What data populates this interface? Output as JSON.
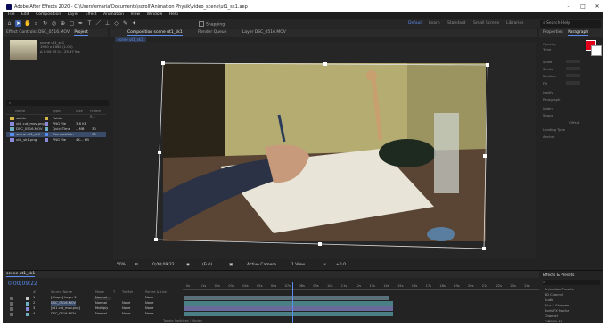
{
  "window": {
    "title": "Adobe After Effects 2020 - C:\\Users\\emaria\\Documents\\scroll\\Animation Physik\\video_scene\\ut1_sk1.aep",
    "controls": [
      "–",
      "□",
      "✕"
    ]
  },
  "menu": [
    "File",
    "Edit",
    "Composition",
    "Layer",
    "Effect",
    "Animation",
    "View",
    "Window",
    "Help"
  ],
  "toolbar": {
    "snapping_label": "Snapping",
    "workspaces": [
      "Default",
      "Learn",
      "Standard",
      "Small Screen",
      "Libraries"
    ],
    "active_workspace": "Default",
    "search_placeholder": "Search Help"
  },
  "project_panel": {
    "tabs": [
      "Effect Controls: DSC_0516.MOV",
      "Project"
    ],
    "active_tab": "Project",
    "thumb_info": [
      "scene ut1_sk1",
      "1920 x 1080 (1.00)",
      "Δ 0;00;25;14, 29.97 fps"
    ],
    "search_placeholder": "",
    "columns": [
      "Name",
      "Type",
      "Size",
      "Frame R..."
    ],
    "files": [
      {
        "name": "solids",
        "type": "Folder",
        "size": "",
        "fr": "",
        "color": "#d6b64a"
      },
      {
        "name": "ut1 cut_mov.png",
        "type": "PNG file",
        "size": "3.6 KB",
        "fr": "",
        "color": "#8a8ad8"
      },
      {
        "name": "DSC_0516.MOV",
        "type": "QuickTime",
        "size": "...MB",
        "fr": "30",
        "color": "#6fb0c0"
      },
      {
        "name": "scene ut1_sk1",
        "type": "Composition",
        "size": "",
        "fr": "30",
        "color": "#5a8cf0"
      },
      {
        "name": "ut1_sk1.png",
        "type": "PNG file",
        "size": "4K... KB",
        "fr": "",
        "color": "#8a8ad8"
      }
    ],
    "footer": "8 bpc"
  },
  "viewer": {
    "tabs": [
      "Composition scene ut1_sk1",
      "Render Queue",
      "Layer DSC_0516.MOV"
    ],
    "active_tab": "Composition scene ut1_sk1",
    "breadcrumb": "scene ut1_sk1",
    "footer": {
      "zoom": "50%",
      "timecode": "0;00;09;22",
      "resolution": "(Full)",
      "camera": "Active Camera",
      "views": "1 View",
      "exposure": "+0.0"
    }
  },
  "properties_panel": {
    "tabs": [
      "Properties",
      "Paragraph",
      "Align",
      "Info",
      "Audio",
      "Preview",
      "Effects",
      "Character"
    ],
    "active_tab": "Paragraph",
    "labels": [
      "Opacity",
      "Time",
      "Scale",
      "Stroke",
      "Position",
      "Fill",
      "Justify",
      "Paragraph",
      "Indent",
      "Space",
      "Offset",
      "Leading Type",
      "Anchor"
    ],
    "swatch_fill": "#e0001a",
    "swatch_stroke": "#ffffff"
  },
  "timeline": {
    "tab": "scene ut1_sk1",
    "timecode": "0;00;09;22",
    "columns": [
      "#",
      "Source Name",
      "Mode",
      "T",
      "TrkMat",
      "Parent & Link"
    ],
    "layers": [
      {
        "num": "1",
        "name": "[Shape] Layer 2",
        "mode": "Normal",
        "trk": "",
        "parent": "None",
        "color": "#c7c7c7",
        "bar": "#5a6f7a"
      },
      {
        "num": "2",
        "name": "DSC_0516.MOV",
        "mode": "Normal",
        "trk": "None",
        "parent": "None",
        "color": "#6fb0c0",
        "bar": "#4a7f86"
      },
      {
        "num": "3",
        "name": "[ut1 cut_mov.png]",
        "mode": "Multiply",
        "trk": "None",
        "parent": "None",
        "color": "#8a8ad8",
        "bar": "#6a6a9a"
      },
      {
        "num": "4",
        "name": "DSC_0516.MOV",
        "mode": "Normal",
        "trk": "None",
        "parent": "None",
        "color": "#6fb0c0",
        "bar": "#4a7f86"
      }
    ],
    "ruler_marks": [
      "0s",
      "01s",
      "02s",
      "03s",
      "04s",
      "05s",
      "06s",
      "07s",
      "08s",
      "09s",
      "10s",
      "11s",
      "12s",
      "13s",
      "14s",
      "15s",
      "16s",
      "17s",
      "18s",
      "19s",
      "20s",
      "21s",
      "22s",
      "23s",
      "24s"
    ],
    "footer": "Toggle Switches / Modes"
  },
  "effects_panel": {
    "title": "Effects & Presets",
    "search_placeholder": "",
    "items": [
      "Animation Presets",
      "3D Channel",
      "Audio",
      "Blur & Sharpen",
      "Boris FX Mocha",
      "Channel",
      "CINEMA 4D"
    ]
  }
}
